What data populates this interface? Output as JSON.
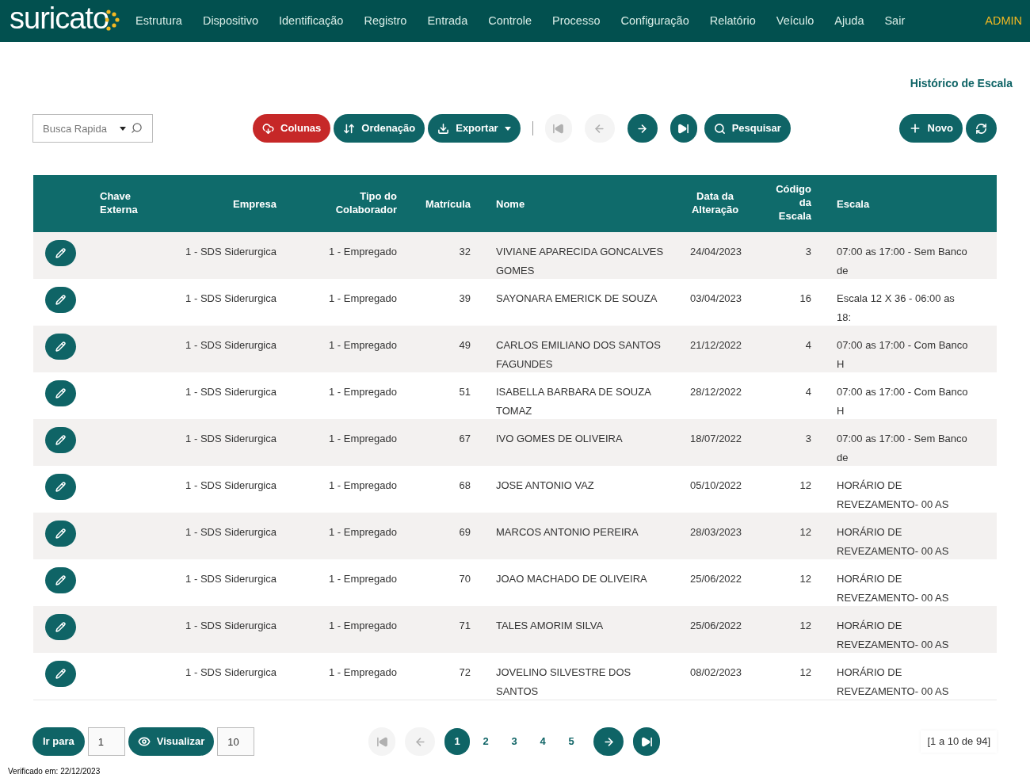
{
  "brand": {
    "name": "suricato"
  },
  "menu": [
    "Estrutura",
    "Dispositivo",
    "Identificação",
    "Registro",
    "Entrada",
    "Controle",
    "Processo",
    "Configuração",
    "Relatório",
    "Veículo",
    "Ajuda",
    "Sair"
  ],
  "user": "ADMIN",
  "page_title": "Histórico de Escala",
  "search": {
    "placeholder": "Busca Rapida"
  },
  "toolbar": {
    "buttons": [
      {
        "kind": "columns",
        "label": "Colunas"
      },
      {
        "kind": "sort",
        "label": "Ordenação"
      },
      {
        "kind": "export",
        "label": "Exportar"
      }
    ],
    "nav": [
      {
        "kind": "first",
        "disabled": true
      },
      {
        "kind": "prev",
        "disabled": true
      },
      {
        "kind": "next",
        "disabled": false
      },
      {
        "kind": "last",
        "disabled": false
      }
    ],
    "search_button": "Pesquisar",
    "new_button": "Novo"
  },
  "table": {
    "columns": [
      "Chave Externa",
      "Empresa",
      "Tipo do Colaborador",
      "Matrícula",
      "Nome",
      "Data da Alteração",
      "Código da Escala",
      "Escala"
    ],
    "rows": [
      {
        "cells": [
          "",
          "1 - SDS Siderurgica",
          "1 - Empregado",
          "32",
          "VIVIANE APARECIDA GONCALVES GOMES",
          "24/04/2023",
          "3",
          "07:00 as 17:00 - Sem Banco de"
        ]
      },
      {
        "cells": [
          "",
          "1 - SDS Siderurgica",
          "1 - Empregado",
          "39",
          "SAYONARA EMERICK DE SOUZA",
          "03/04/2023",
          "16",
          "Escala 12 X 36 - 06:00 as 18:"
        ]
      },
      {
        "cells": [
          "",
          "1 - SDS Siderurgica",
          "1 - Empregado",
          "49",
          "CARLOS EMILIANO DOS SANTOS FAGUNDES",
          "21/12/2022",
          "4",
          "07:00 as 17:00 - Com Banco H"
        ]
      },
      {
        "cells": [
          "",
          "1 - SDS Siderurgica",
          "1 - Empregado",
          "51",
          "ISABELLA BARBARA DE SOUZA TOMAZ",
          "28/12/2022",
          "4",
          "07:00 as 17:00 - Com Banco H"
        ]
      },
      {
        "cells": [
          "",
          "1 - SDS Siderurgica",
          "1 - Empregado",
          "67",
          "IVO GOMES DE OLIVEIRA",
          "18/07/2022",
          "3",
          "07:00 as 17:00 - Sem Banco de"
        ]
      },
      {
        "cells": [
          "",
          "1 - SDS Siderurgica",
          "1 - Empregado",
          "68",
          "JOSE ANTONIO VAZ",
          "05/10/2022",
          "12",
          "HORÁRIO DE REVEZAMENTO- 00 AS"
        ]
      },
      {
        "cells": [
          "",
          "1 - SDS Siderurgica",
          "1 - Empregado",
          "69",
          "MARCOS ANTONIO PEREIRA",
          "28/03/2023",
          "12",
          "HORÁRIO DE REVEZAMENTO- 00 AS"
        ]
      },
      {
        "cells": [
          "",
          "1 - SDS Siderurgica",
          "1 - Empregado",
          "70",
          "JOAO MACHADO DE OLIVEIRA",
          "25/06/2022",
          "12",
          "HORÁRIO DE REVEZAMENTO- 00 AS"
        ]
      },
      {
        "cells": [
          "",
          "1 - SDS Siderurgica",
          "1 - Empregado",
          "71",
          "TALES AMORIM SILVA",
          "25/06/2022",
          "12",
          "HORÁRIO DE REVEZAMENTO- 00 AS"
        ]
      },
      {
        "cells": [
          "",
          "1 - SDS Siderurgica",
          "1 - Empregado",
          "72",
          "JOVELINO SILVESTRE DOS SANTOS",
          "08/02/2023",
          "12",
          "HORÁRIO DE REVEZAMENTO- 00 AS"
        ]
      }
    ]
  },
  "footer": {
    "goto_button": "Ir para",
    "goto_value": "1",
    "view_button": "Visualizar",
    "view_value": "10",
    "nav": [
      {
        "kind": "first",
        "disabled": true
      },
      {
        "kind": "prev",
        "disabled": true
      },
      {
        "kind": "next",
        "disabled": false
      },
      {
        "kind": "last",
        "disabled": false
      }
    ],
    "pages": [
      {
        "label": "1",
        "selected": true
      },
      {
        "label": "2",
        "selected": false
      },
      {
        "label": "3",
        "selected": false
      },
      {
        "label": "4",
        "selected": false
      },
      {
        "label": "5",
        "selected": false
      }
    ],
    "range": "[1 a 10 de 94]",
    "verified": "Verificado em: 22/12/2023"
  }
}
